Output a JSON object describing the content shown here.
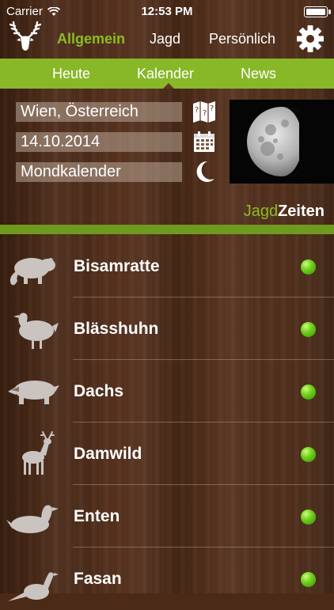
{
  "status_bar": {
    "carrier": "Carrier",
    "time": "12:53 PM"
  },
  "top_nav": {
    "tabs": [
      {
        "label": "Allgemein",
        "active": true
      },
      {
        "label": "Jagd",
        "active": false
      },
      {
        "label": "Persönlich",
        "active": false
      }
    ]
  },
  "sub_nav": {
    "tabs": [
      {
        "label": "Heute"
      },
      {
        "label": "Kalender",
        "active": true
      },
      {
        "label": "News"
      }
    ]
  },
  "filters": {
    "location": "Wien, Österreich",
    "date": "14.10.2014",
    "calendar_type": "Mondkalender"
  },
  "brand": {
    "part1": "Jagd",
    "part2": "Zeiten"
  },
  "colors": {
    "accent": "#88b828",
    "status_open": "#6fd11d",
    "background": "#4b2a17"
  },
  "species": [
    {
      "name": "Bisamratte",
      "icon": "muskrat-icon",
      "status": "open"
    },
    {
      "name": "Blässhuhn",
      "icon": "coot-icon",
      "status": "open"
    },
    {
      "name": "Dachs",
      "icon": "badger-icon",
      "status": "open"
    },
    {
      "name": "Damwild",
      "icon": "fallow-deer-icon",
      "status": "open"
    },
    {
      "name": "Enten",
      "icon": "duck-icon",
      "status": "open"
    },
    {
      "name": "Fasan",
      "icon": "pheasant-icon",
      "status": "open"
    }
  ]
}
